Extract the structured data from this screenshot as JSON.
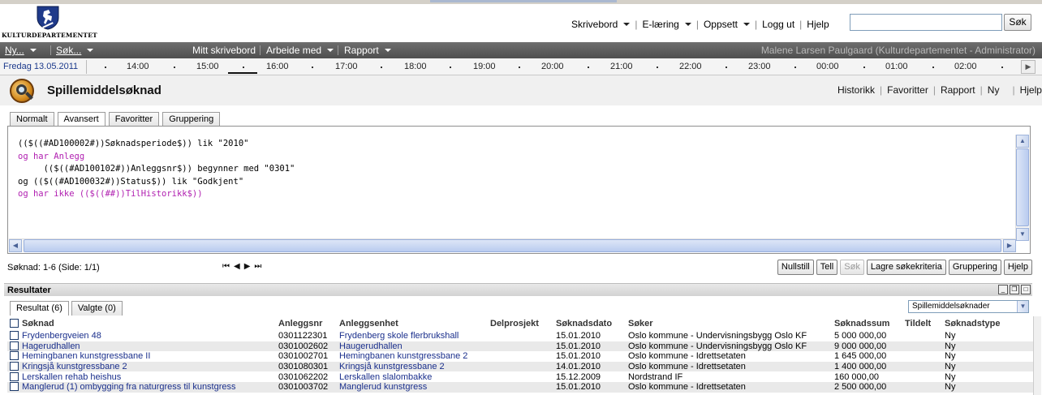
{
  "header": {
    "org_name": "KULTURDEPARTEMENTET",
    "nav": [
      {
        "label": "Skrivebord",
        "dropdown": true
      },
      {
        "label": "E-læring",
        "dropdown": true
      },
      {
        "label": "Oppsett",
        "dropdown": true
      },
      {
        "label": "Logg ut",
        "dropdown": false
      },
      {
        "label": "Hjelp",
        "dropdown": false
      }
    ],
    "search_value": "",
    "search_button": "Søk"
  },
  "menubar": {
    "new": "Ny...",
    "search": "Søk...",
    "my_desk": "Mitt skrivebord",
    "work": "Arbeide med",
    "report": "Rapport",
    "user": "Malene Larsen Paulgaard (Kulturdepartementet - Administrator)"
  },
  "timeline": {
    "date": "Fredag 13.05.2011",
    "hours": [
      "14:00",
      "15:00",
      "16:00",
      "17:00",
      "18:00",
      "19:00",
      "20:00",
      "21:00",
      "22:00",
      "23:00",
      "00:00",
      "01:00",
      "02:00"
    ]
  },
  "page": {
    "title": "Spillemiddelsøknad",
    "actions": [
      "Historikk",
      "Favoritter",
      "Rapport",
      "Ny",
      "Hjelp"
    ]
  },
  "search_tabs": [
    "Normalt",
    "Avansert",
    "Favoritter",
    "Gruppering"
  ],
  "active_search_tab": "Avansert",
  "query_lines": [
    {
      "text": "(($((#AD100002#))Søknadsperiode$)) lik \"2010\"",
      "keyword": false
    },
    {
      "text": "og har Anlegg",
      "keyword": true
    },
    {
      "text": "     (($((#AD100102#))Anleggsnr$)) begynner med \"0301\"",
      "keyword": false
    },
    {
      "text": "og (($((#AD100032#))Status$)) lik \"Godkjent\"",
      "keyword": false
    },
    {
      "text": "og har ikke (($((##))TilHistorikk$))",
      "keyword": true
    }
  ],
  "result_status": "Søknad: 1-6 (Side: 1/1)",
  "buttons": [
    "Nullstill",
    "Tell",
    "Søk",
    "Lagre søkekriteria",
    "Gruppering",
    "Hjelp"
  ],
  "results": {
    "title": "Resultater",
    "tabs": [
      "Resultat (6)",
      "Valgte (0)"
    ],
    "dropdown": "Spillemiddelsøknader",
    "columns": [
      "Søknad",
      "Anleggsnr",
      "Anleggsenhet",
      "Delprosjekt",
      "Søknadsdato",
      "Søker",
      "Søknadssum",
      "Tildelt",
      "Søknadstype"
    ],
    "rows": [
      [
        "Frydenbergveien 48",
        "0301122301",
        "Frydenberg skole flerbrukshall",
        "",
        "15.01.2010",
        "Oslo kommune - Undervisningsbygg Oslo KF",
        "5 000 000,00",
        "",
        "Ny"
      ],
      [
        "Hagerudhallen",
        "0301002602",
        "Haugerudhallen",
        "",
        "15.01.2010",
        "Oslo kommune - Undervisningsbygg Oslo KF",
        "9 000 000,00",
        "",
        "Ny"
      ],
      [
        "Hemingbanen kunstgressbane II",
        "0301002701",
        "Hemingbanen kunstgressbane 2",
        "",
        "15.01.2010",
        "Oslo kommune - Idrettsetaten",
        "1 645 000,00",
        "",
        "Ny"
      ],
      [
        "Kringsjå kunstgressbane 2",
        "0301080301",
        "Kringsjå kunstgressbane 2",
        "",
        "14.01.2010",
        "Oslo kommune - Idrettsetaten",
        "1 400 000,00",
        "",
        "Ny"
      ],
      [
        "Lerskallen rehab heishus",
        "0301062202",
        "Lerskallen slalombakke",
        "",
        "15.12.2009",
        "Nordstrand IF",
        "160 000,00",
        "",
        "Ny"
      ],
      [
        "Manglerud (1) ombygging fra naturgress til kunstgress",
        "0301003702",
        "Manglerud kunstgress",
        "",
        "15.01.2010",
        "Oslo kommune - Idrettsetaten",
        "2 500 000,00",
        "",
        "Ny"
      ]
    ]
  }
}
